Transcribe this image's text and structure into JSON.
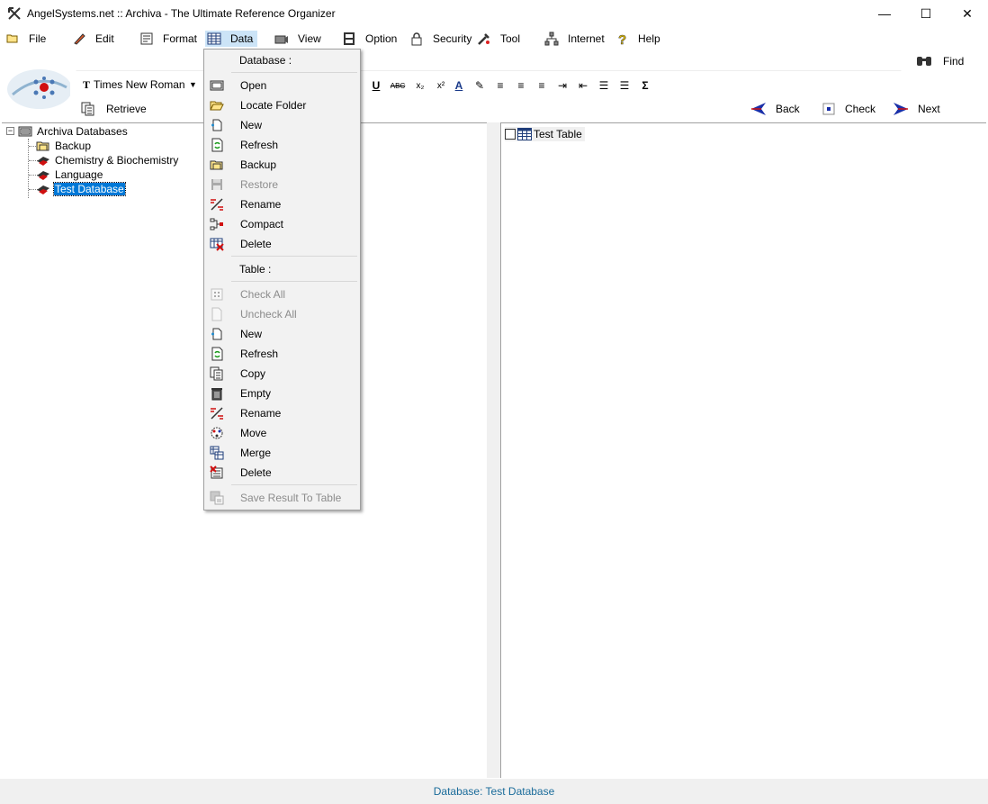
{
  "window": {
    "title": "AngelSystems.net :: Archiva - The Ultimate Reference Organizer",
    "minimize": "—",
    "maximize": "☐",
    "close": "✕"
  },
  "menu": [
    {
      "label": "File",
      "icon": "folder-icon"
    },
    {
      "label": "Edit",
      "icon": "pen-icon"
    },
    {
      "label": "Format",
      "icon": "format-icon"
    },
    {
      "label": "Data",
      "icon": "table-icon"
    },
    {
      "label": "View",
      "icon": "camera-icon"
    },
    {
      "label": "Option",
      "icon": "option-icon"
    },
    {
      "label": "Security",
      "icon": "lock-icon"
    },
    {
      "label": "Tool",
      "icon": "tool-icon"
    },
    {
      "label": "Internet",
      "icon": "network-icon"
    },
    {
      "label": "Help",
      "icon": "help-icon"
    }
  ],
  "toolbar": {
    "search_value": "",
    "find_label": "Find",
    "font_name": "Times New Roman",
    "font_icon": "T",
    "retrieve_label": "Retrieve",
    "back_label": "Back",
    "check_label": "Check",
    "next_label": "Next",
    "format_buttons": [
      {
        "name": "underline-button",
        "text": "U"
      },
      {
        "name": "strikethrough-button",
        "text": "ABC"
      },
      {
        "name": "subscript-button",
        "text": "x₂"
      },
      {
        "name": "superscript-button",
        "text": "x²"
      },
      {
        "name": "font-color-button",
        "text": "A"
      },
      {
        "name": "highlight-button",
        "text": "✎"
      },
      {
        "name": "align-left-button",
        "text": "≡"
      },
      {
        "name": "align-center-button",
        "text": "≡"
      },
      {
        "name": "align-right-button",
        "text": "≡"
      },
      {
        "name": "indent-button",
        "text": "⇥"
      },
      {
        "name": "outdent-button",
        "text": "⇤"
      },
      {
        "name": "bullet-list-button",
        "text": "☰"
      },
      {
        "name": "numbered-list-button",
        "text": "☰"
      },
      {
        "name": "sum-button",
        "text": "Σ"
      }
    ]
  },
  "tree": {
    "root": "Archiva Databases",
    "expander": "−",
    "children": [
      "Backup",
      "Chemistry & Biochemistry",
      "Language",
      "Test Database"
    ]
  },
  "tables": [
    {
      "label": "Test Table"
    }
  ],
  "dropdown": {
    "database_header": "Database :",
    "database_items": [
      {
        "label": "Open",
        "icon": "open-db-icon",
        "enabled": true
      },
      {
        "label": "Locate Folder",
        "icon": "folder-open-icon",
        "enabled": true
      },
      {
        "label": "New",
        "icon": "new-icon",
        "enabled": true
      },
      {
        "label": "Refresh",
        "icon": "refresh-icon",
        "enabled": true
      },
      {
        "label": "Backup",
        "icon": "backup-icon",
        "enabled": true
      },
      {
        "label": "Restore",
        "icon": "restore-icon",
        "enabled": false
      },
      {
        "label": "Rename",
        "icon": "rename-icon",
        "enabled": true
      },
      {
        "label": "Compact",
        "icon": "compact-icon",
        "enabled": true
      },
      {
        "label": "Delete",
        "icon": "delete-db-icon",
        "enabled": true
      }
    ],
    "table_header": "Table :",
    "table_items": [
      {
        "label": "Check All",
        "icon": "check-all-icon",
        "enabled": false
      },
      {
        "label": "Uncheck All",
        "icon": "uncheck-all-icon",
        "enabled": false
      },
      {
        "label": "New",
        "icon": "new-icon",
        "enabled": true
      },
      {
        "label": "Refresh",
        "icon": "refresh-icon",
        "enabled": true
      },
      {
        "label": "Copy",
        "icon": "copy-icon",
        "enabled": true
      },
      {
        "label": "Empty",
        "icon": "trash-icon",
        "enabled": true
      },
      {
        "label": "Rename",
        "icon": "rename-icon",
        "enabled": true
      },
      {
        "label": "Move",
        "icon": "move-icon",
        "enabled": true
      },
      {
        "label": "Merge",
        "icon": "merge-icon",
        "enabled": true
      },
      {
        "label": "Delete",
        "icon": "delete-table-icon",
        "enabled": true
      }
    ],
    "save_result": {
      "label": "Save Result To Table",
      "icon": "save-result-icon",
      "enabled": false
    }
  },
  "status": {
    "text": "Database: Test Database"
  },
  "colors": {
    "selection": "#0078d7",
    "status_text": "#1a6b9a",
    "menu_bg": "#f2f2f2"
  }
}
